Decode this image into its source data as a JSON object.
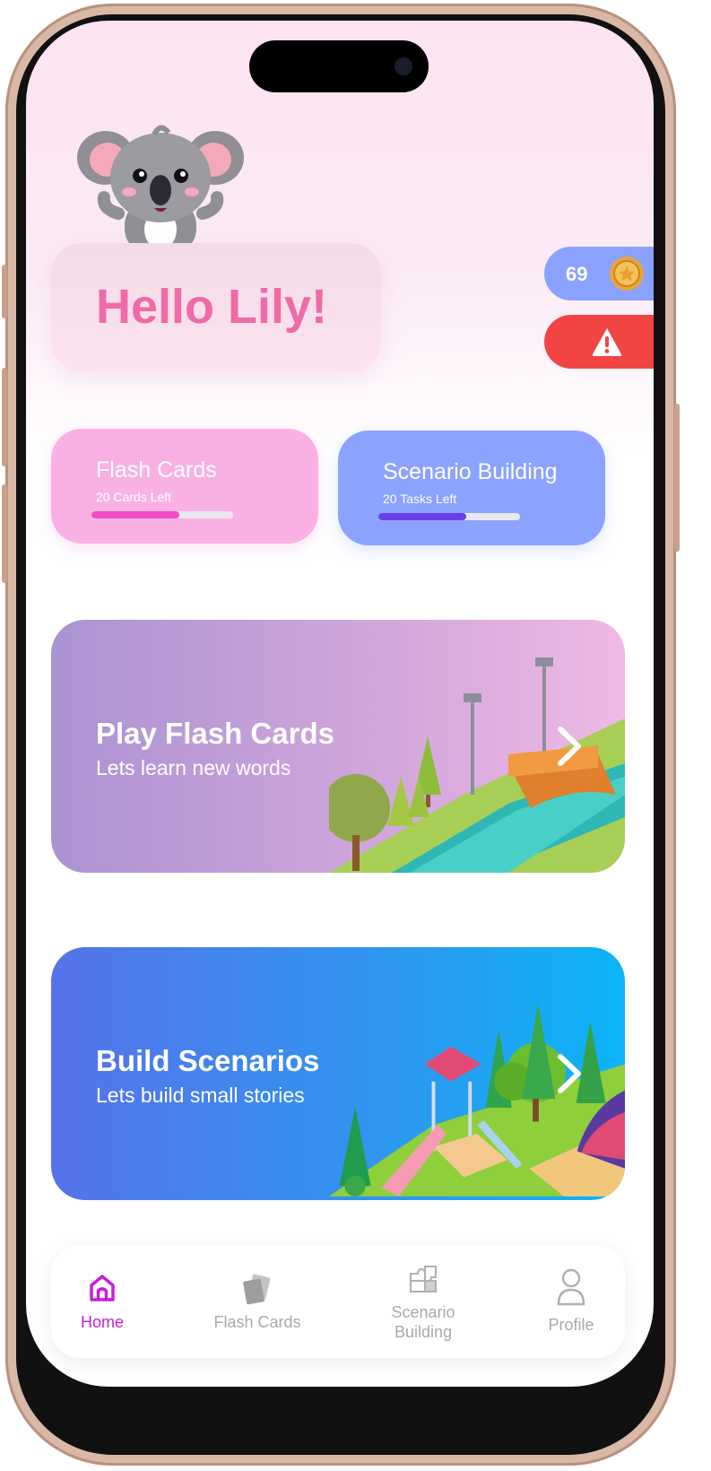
{
  "greeting": "Hello Lily!",
  "coins": {
    "count": "69",
    "icon": "coin-icon"
  },
  "alert": {
    "icon": "warning-icon"
  },
  "progress_cards": [
    {
      "title": "Flash Cards",
      "subtitle": "20 Cards Left",
      "progress": 0.62,
      "color": "#f24bc6"
    },
    {
      "title": "Scenario Building",
      "subtitle": "20 Tasks Left",
      "progress": 0.62,
      "color": "#6b3cf0"
    }
  ],
  "activities": [
    {
      "title": "Play Flash Cards",
      "subtitle": "Lets learn new words"
    },
    {
      "title": "Build Scenarios",
      "subtitle": "Lets build small stories"
    }
  ],
  "nav": [
    {
      "label": "Home",
      "icon": "home-icon",
      "active": true
    },
    {
      "label": "Flash Cards",
      "icon": "cards-icon",
      "active": false
    },
    {
      "label": "Scenario Building",
      "icon": "puzzle-icon",
      "active": false
    },
    {
      "label": "Profile",
      "icon": "person-icon",
      "active": false
    }
  ],
  "colors": {
    "accent": "#c61fd6",
    "greeting": "#ef6aa6",
    "coin_pill": "#8aa2ff",
    "alert_pill": "#f34444"
  }
}
